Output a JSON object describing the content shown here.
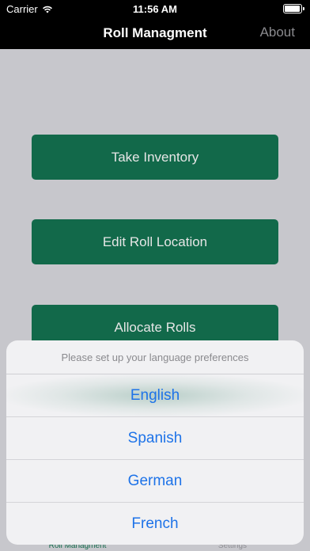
{
  "status": {
    "carrier": "Carrier",
    "time": "11:56 AM"
  },
  "nav": {
    "title": "Roll Managment",
    "about_label": "About"
  },
  "main": {
    "buttons": [
      {
        "label": "Take Inventory"
      },
      {
        "label": "Edit Roll Location"
      },
      {
        "label": "Allocate Rolls"
      }
    ]
  },
  "tabs": [
    {
      "label": "Roll Managment"
    },
    {
      "label": "Settings"
    }
  ],
  "sheet": {
    "title": "Please set up your language preferences",
    "options": [
      {
        "label": "English"
      },
      {
        "label": "Spanish"
      },
      {
        "label": "German"
      },
      {
        "label": "French"
      }
    ]
  },
  "colors": {
    "accent_green": "#12694a",
    "link_blue": "#1e73e8",
    "background_gray": "#c7c7cc"
  }
}
